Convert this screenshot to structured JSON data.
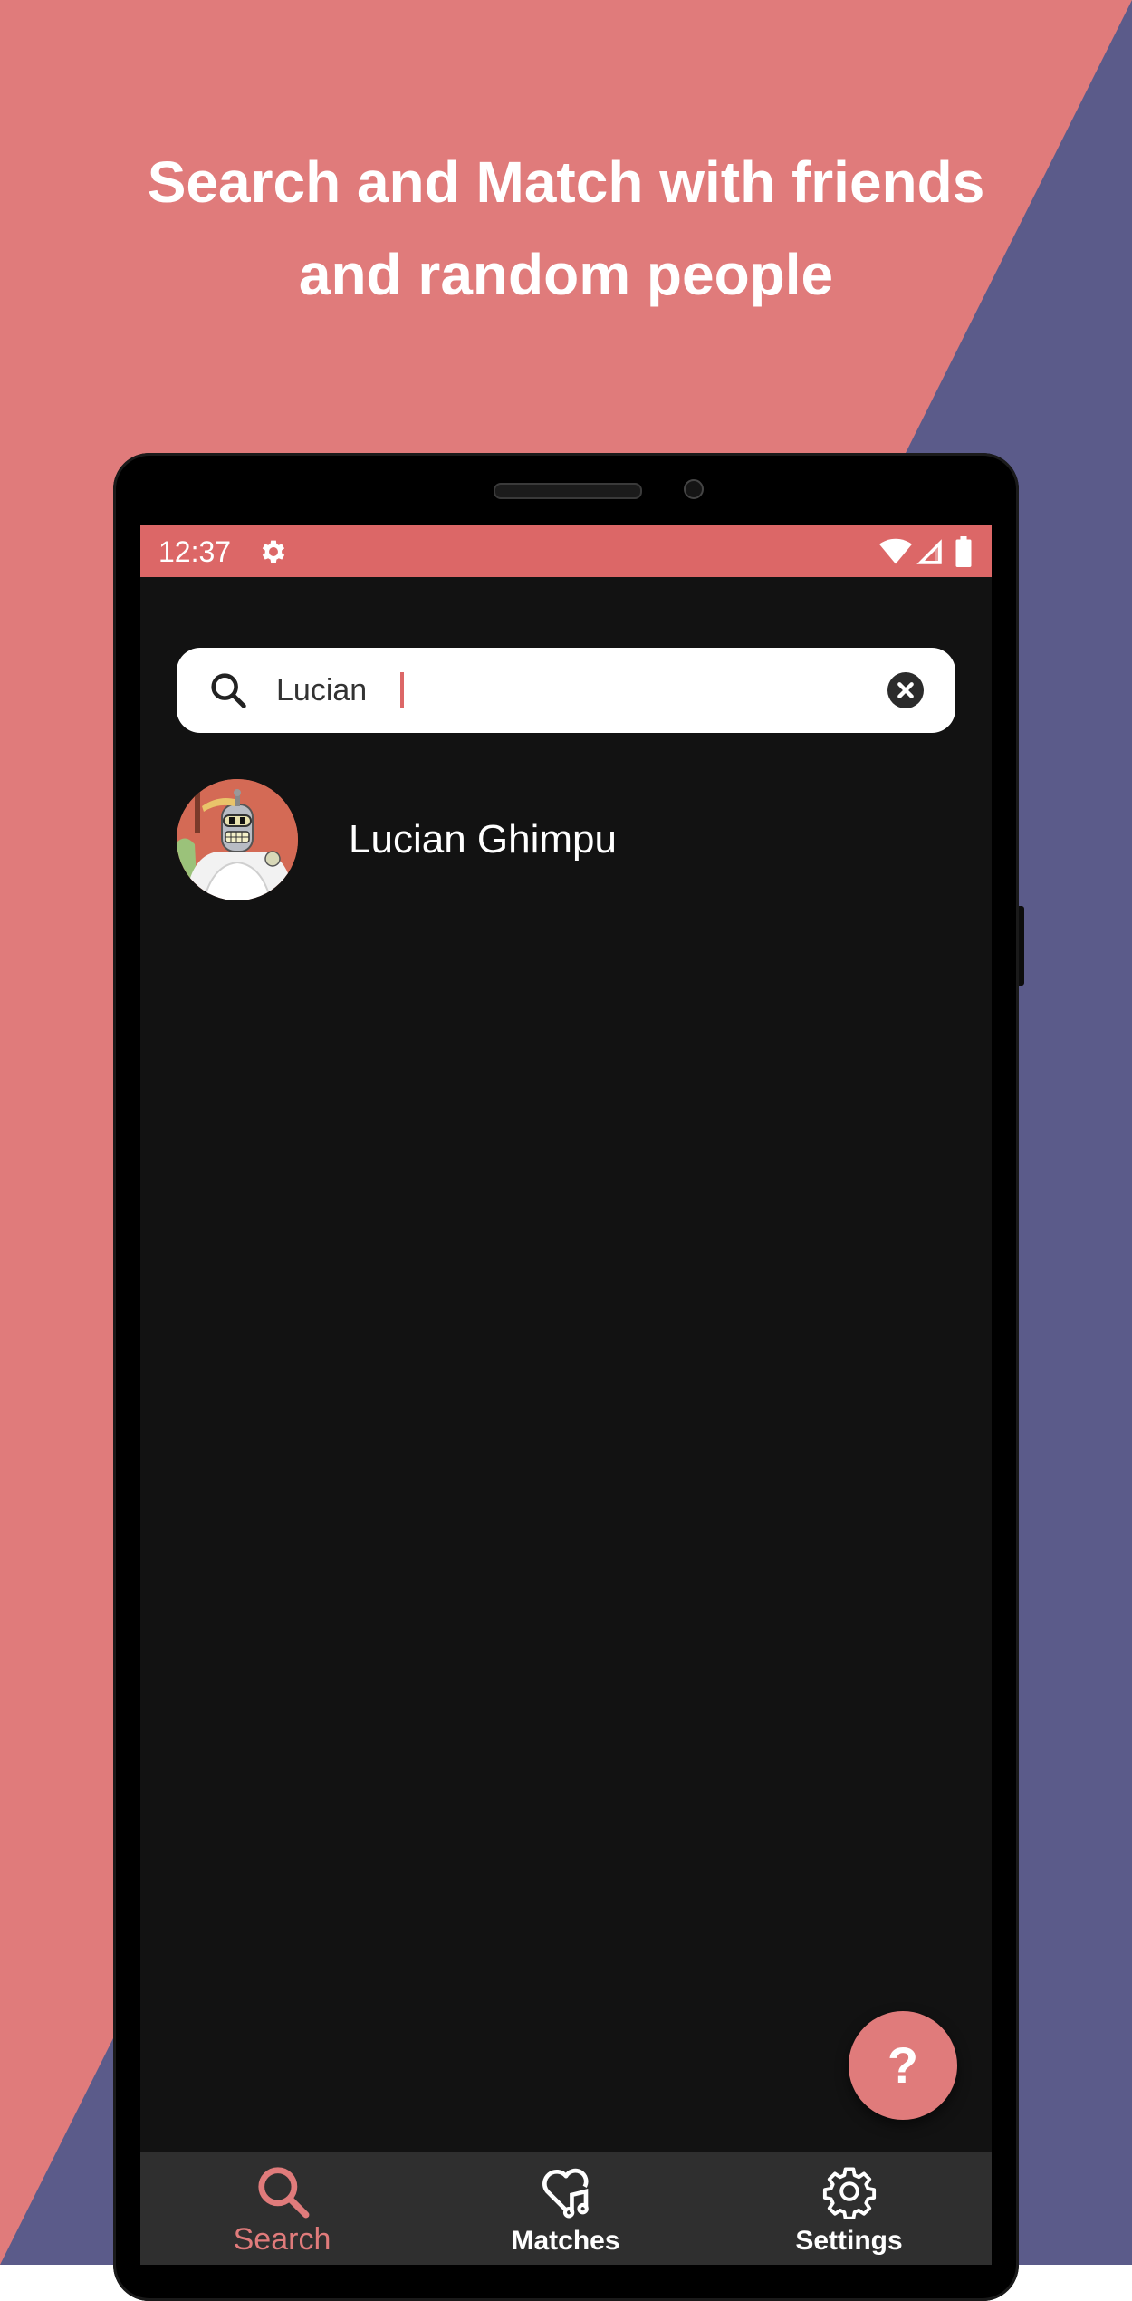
{
  "headline": {
    "line1": "Search and Match with friends",
    "line2": "and random people"
  },
  "colors": {
    "background_left": "#e07b7b",
    "background_right": "#5b5b8a",
    "accent": "#dc6767",
    "screen": "#121212",
    "nav": "#2f2f2f"
  },
  "status_bar": {
    "time": "12:37",
    "icons": [
      "gear-icon",
      "wifi-icon",
      "signal-icon",
      "battery-icon"
    ]
  },
  "search": {
    "value": "Lucian",
    "icon": "search-icon",
    "clear_icon": "clear-icon"
  },
  "results": [
    {
      "name": "Lucian Ghimpu",
      "avatar": "robot-avatar"
    }
  ],
  "fab": {
    "label": "?"
  },
  "bottom_nav": {
    "items": [
      {
        "label": "Search",
        "icon": "search-icon",
        "active": true
      },
      {
        "label": "Matches",
        "icon": "heart-music-icon",
        "active": false
      },
      {
        "label": "Settings",
        "icon": "gear-icon",
        "active": false
      }
    ]
  }
}
